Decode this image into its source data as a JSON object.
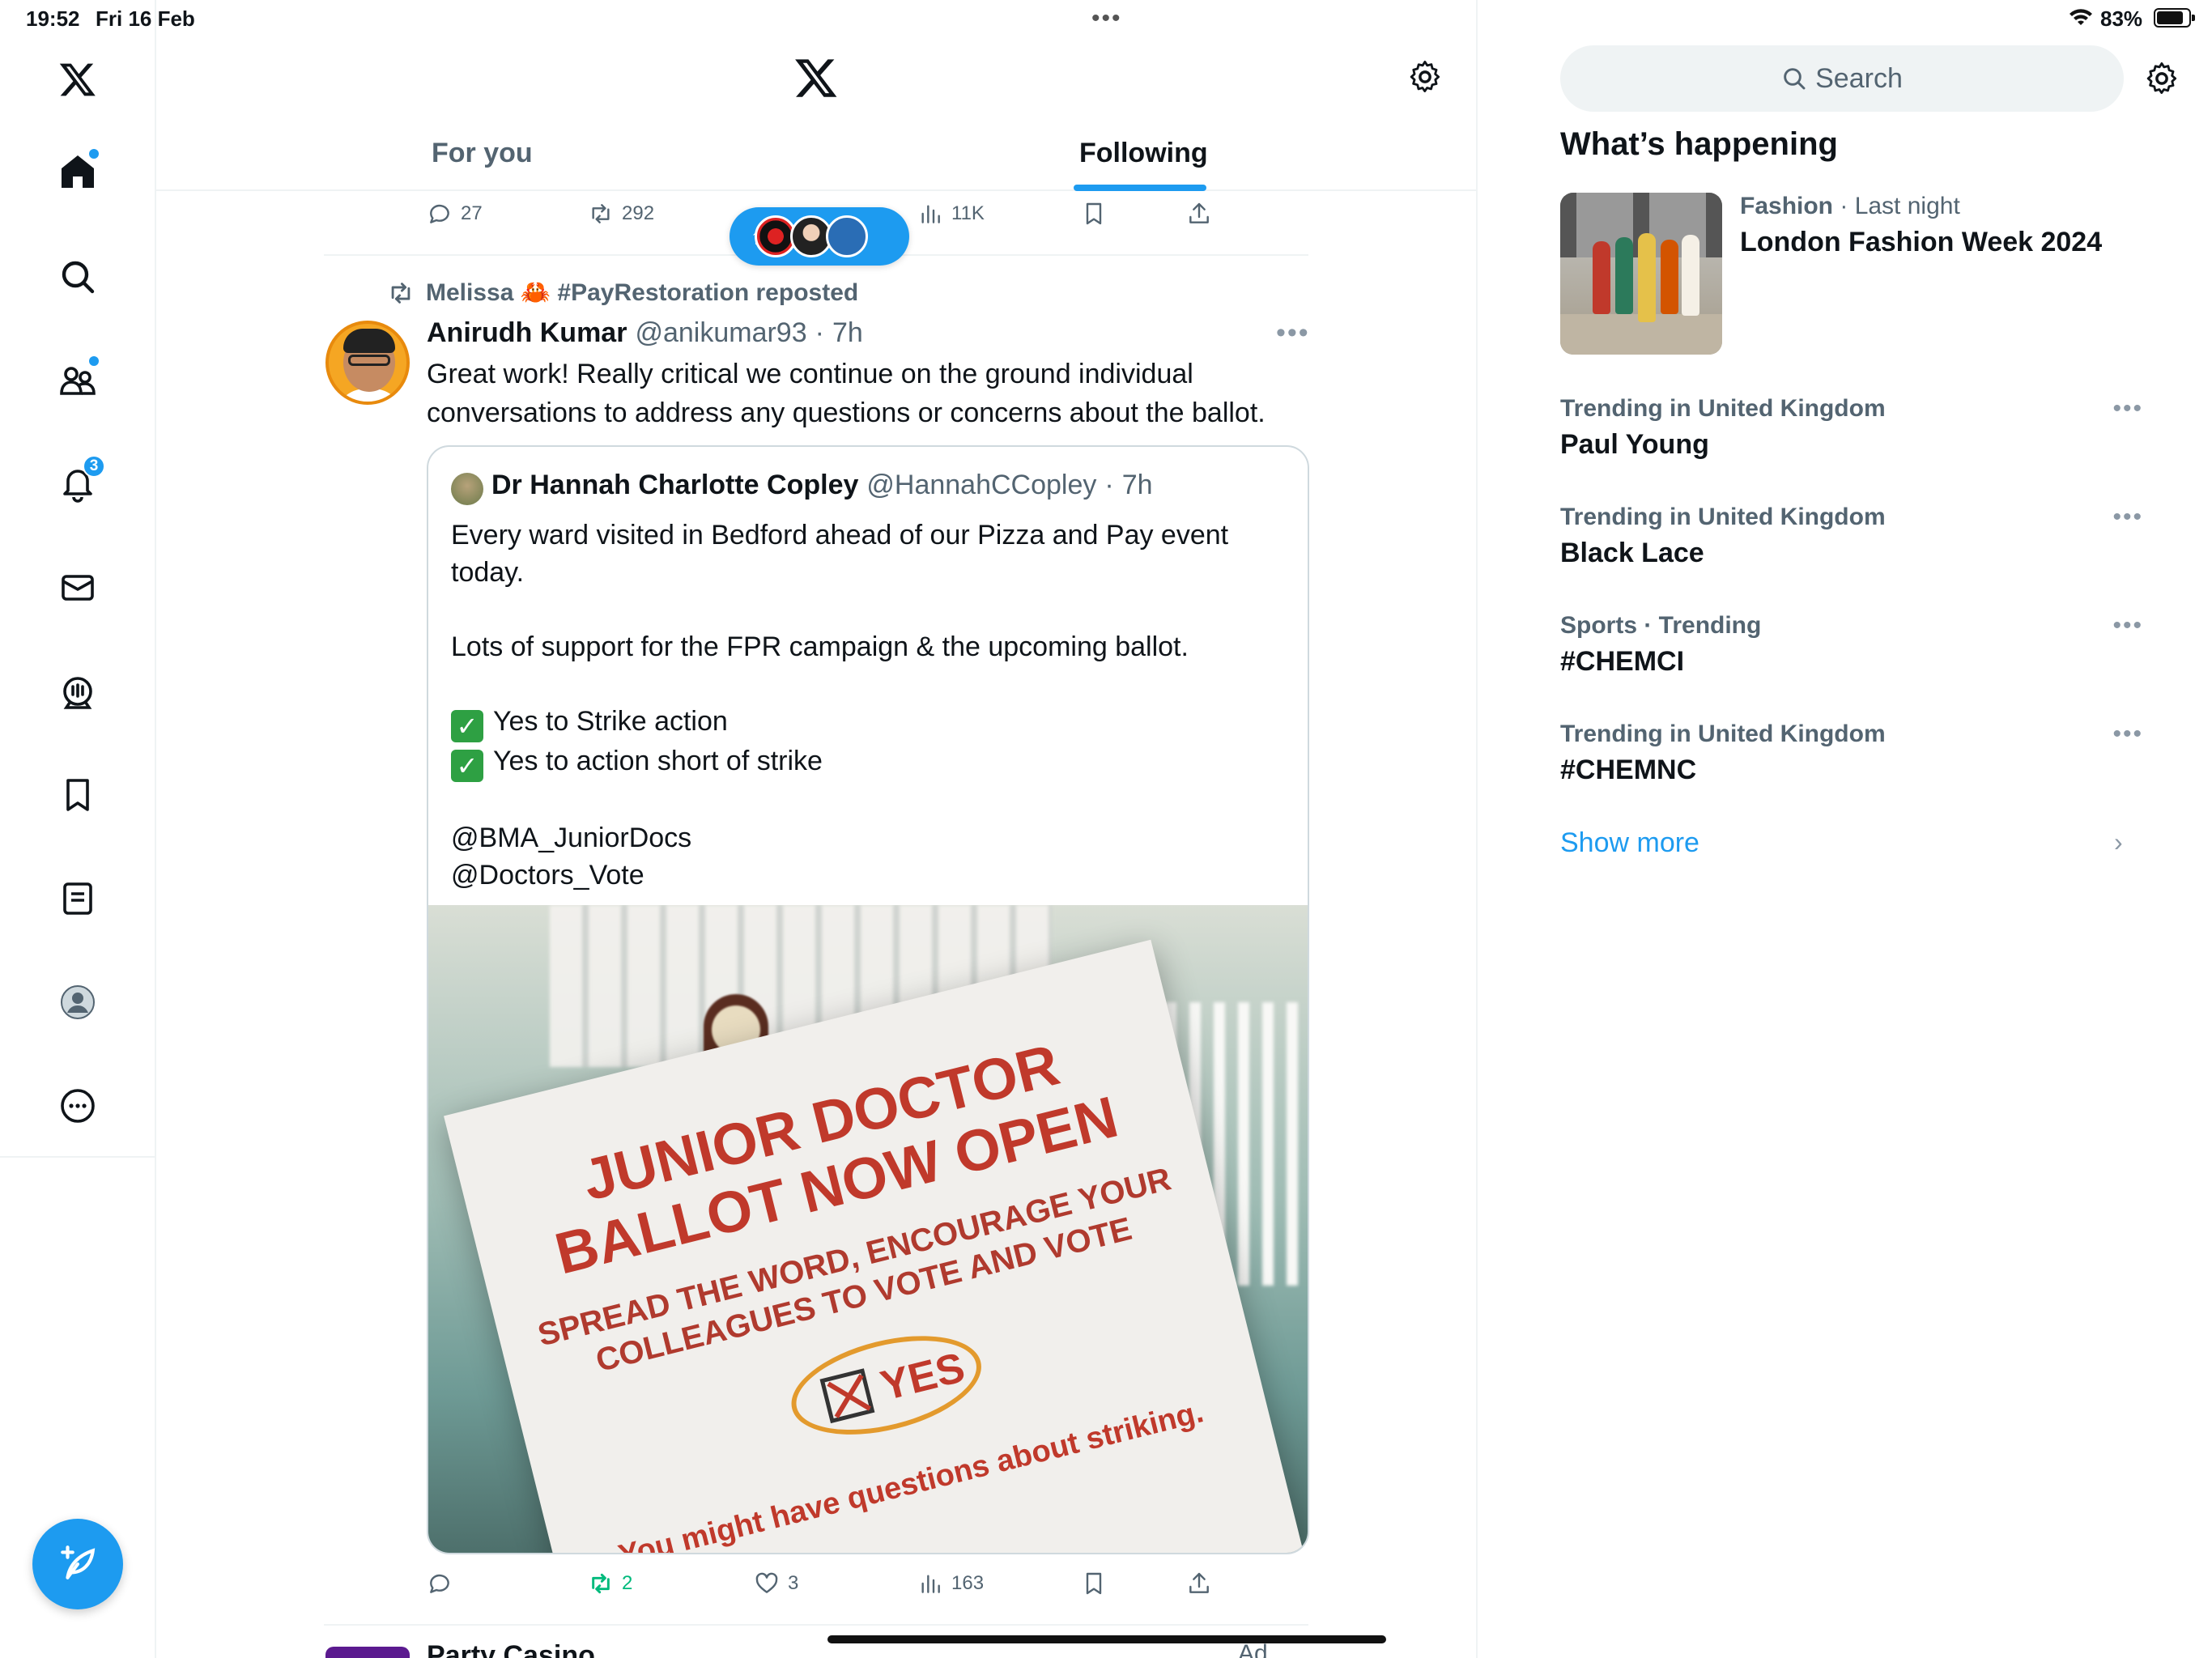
{
  "status_bar": {
    "time": "19:52",
    "date": "Fri 16 Feb",
    "battery": "83%",
    "battery_level": 0.83
  },
  "colors": {
    "accent": "#1d9bf0",
    "text": "#0f1419",
    "secondary_text": "#536471",
    "repost_green": "#00ba7c",
    "divider": "#eff3f4"
  },
  "left_nav": {
    "items": [
      {
        "name": "home",
        "icon": "home-icon",
        "has_dot": true
      },
      {
        "name": "explore",
        "icon": "search-icon"
      },
      {
        "name": "communities",
        "icon": "communities-icon",
        "has_dot": true
      },
      {
        "name": "notifications",
        "icon": "bell-icon",
        "badge": "3"
      },
      {
        "name": "messages",
        "icon": "mail-icon"
      },
      {
        "name": "spaces",
        "icon": "spaces-icon"
      },
      {
        "name": "bookmarks",
        "icon": "bookmark-icon"
      },
      {
        "name": "lists",
        "icon": "list-icon"
      },
      {
        "name": "profile",
        "icon": "profile-icon"
      },
      {
        "name": "more",
        "icon": "more-circle-icon"
      }
    ],
    "compose_icon": "compose-icon"
  },
  "header": {
    "logo": "x-logo-icon",
    "settings_icon": "gear-icon",
    "tabs": [
      {
        "label": "For you",
        "active": false
      },
      {
        "label": "Following",
        "active": true
      }
    ]
  },
  "previous_post_actions": {
    "replies": "27",
    "reposts": "292",
    "views": "11K"
  },
  "new_posts_pill": {
    "icon": "arrow-up-icon"
  },
  "post": {
    "reposted_by": "Melissa 🦀 #PayRestoration reposted",
    "author_name": "Anirudh Kumar",
    "author_handle": "@anikumar93",
    "time": "7h",
    "text": "Great work! Really critical we continue on the ground individual conversations to address any questions or concerns about the ballot.",
    "quote": {
      "author_name": "Dr Hannah Charlotte Copley",
      "author_handle": "@HannahCCopley",
      "time": "7h",
      "lines": [
        "Every ward visited in Bedford ahead of our Pizza and Pay event today.",
        "",
        "Lots of support for the FPR campaign & the upcoming ballot.",
        "",
        "Yes to Strike action",
        "Yes to action short of strike",
        "",
        "@BMA_JuniorDocs",
        "@Doctors_Vote"
      ],
      "image_text": {
        "line1": "JUNIOR DOCTOR",
        "line2": "BALLOT NOW OPEN",
        "line3": "SPREAD THE WORD, ENCOURAGE YOUR",
        "line4": "COLLEAGUES TO VOTE AND VOTE",
        "yes": "YES",
        "line5": "You might have questions about striking."
      }
    },
    "actions": {
      "replies": "",
      "reposts": "2",
      "likes": "3",
      "views": "163"
    }
  },
  "next_post": {
    "author_partial": "Party Casino",
    "ad_label": "Ad"
  },
  "sidebar": {
    "search_placeholder": "Search",
    "settings_icon": "gear-icon",
    "title": "What’s happening",
    "featured": {
      "category": "Fashion",
      "time": "Last night",
      "title": "London Fashion Week 2024"
    },
    "trends": [
      {
        "meta": "Trending in United Kingdom",
        "name": "Paul Young"
      },
      {
        "meta": "Trending in United Kingdom",
        "name": "Black Lace"
      },
      {
        "meta": "Sports · Trending",
        "name": "#CHEMCI"
      },
      {
        "meta": "Trending in United Kingdom",
        "name": "#CHEMNC"
      }
    ],
    "show_more": "Show more"
  }
}
